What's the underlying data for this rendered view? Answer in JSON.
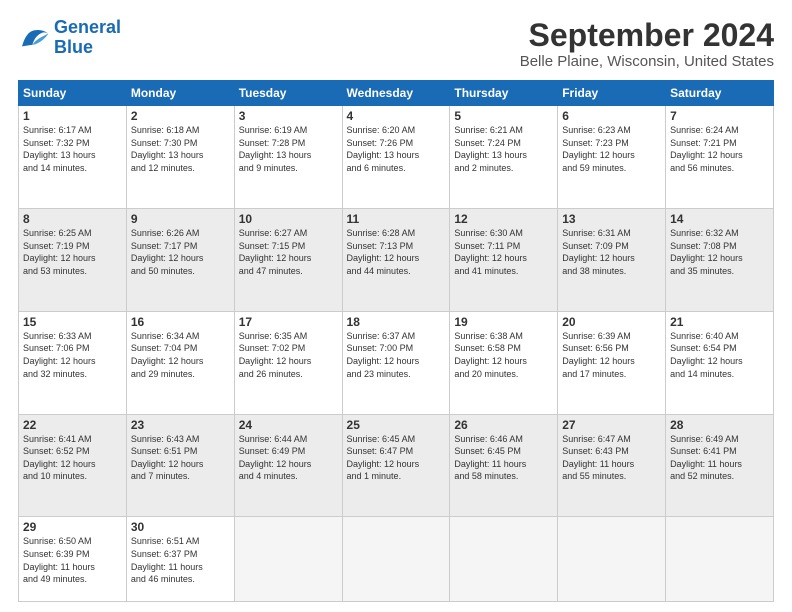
{
  "logo": {
    "line1": "General",
    "line2": "Blue"
  },
  "title": "September 2024",
  "subtitle": "Belle Plaine, Wisconsin, United States",
  "days_of_week": [
    "Sunday",
    "Monday",
    "Tuesday",
    "Wednesday",
    "Thursday",
    "Friday",
    "Saturday"
  ],
  "weeks": [
    [
      {
        "day": "1",
        "info": "Sunrise: 6:17 AM\nSunset: 7:32 PM\nDaylight: 13 hours\nand 14 minutes."
      },
      {
        "day": "2",
        "info": "Sunrise: 6:18 AM\nSunset: 7:30 PM\nDaylight: 13 hours\nand 12 minutes."
      },
      {
        "day": "3",
        "info": "Sunrise: 6:19 AM\nSunset: 7:28 PM\nDaylight: 13 hours\nand 9 minutes."
      },
      {
        "day": "4",
        "info": "Sunrise: 6:20 AM\nSunset: 7:26 PM\nDaylight: 13 hours\nand 6 minutes."
      },
      {
        "day": "5",
        "info": "Sunrise: 6:21 AM\nSunset: 7:24 PM\nDaylight: 13 hours\nand 2 minutes."
      },
      {
        "day": "6",
        "info": "Sunrise: 6:23 AM\nSunset: 7:23 PM\nDaylight: 12 hours\nand 59 minutes."
      },
      {
        "day": "7",
        "info": "Sunrise: 6:24 AM\nSunset: 7:21 PM\nDaylight: 12 hours\nand 56 minutes."
      }
    ],
    [
      {
        "day": "8",
        "info": "Sunrise: 6:25 AM\nSunset: 7:19 PM\nDaylight: 12 hours\nand 53 minutes."
      },
      {
        "day": "9",
        "info": "Sunrise: 6:26 AM\nSunset: 7:17 PM\nDaylight: 12 hours\nand 50 minutes."
      },
      {
        "day": "10",
        "info": "Sunrise: 6:27 AM\nSunset: 7:15 PM\nDaylight: 12 hours\nand 47 minutes."
      },
      {
        "day": "11",
        "info": "Sunrise: 6:28 AM\nSunset: 7:13 PM\nDaylight: 12 hours\nand 44 minutes."
      },
      {
        "day": "12",
        "info": "Sunrise: 6:30 AM\nSunset: 7:11 PM\nDaylight: 12 hours\nand 41 minutes."
      },
      {
        "day": "13",
        "info": "Sunrise: 6:31 AM\nSunset: 7:09 PM\nDaylight: 12 hours\nand 38 minutes."
      },
      {
        "day": "14",
        "info": "Sunrise: 6:32 AM\nSunset: 7:08 PM\nDaylight: 12 hours\nand 35 minutes."
      }
    ],
    [
      {
        "day": "15",
        "info": "Sunrise: 6:33 AM\nSunset: 7:06 PM\nDaylight: 12 hours\nand 32 minutes."
      },
      {
        "day": "16",
        "info": "Sunrise: 6:34 AM\nSunset: 7:04 PM\nDaylight: 12 hours\nand 29 minutes."
      },
      {
        "day": "17",
        "info": "Sunrise: 6:35 AM\nSunset: 7:02 PM\nDaylight: 12 hours\nand 26 minutes."
      },
      {
        "day": "18",
        "info": "Sunrise: 6:37 AM\nSunset: 7:00 PM\nDaylight: 12 hours\nand 23 minutes."
      },
      {
        "day": "19",
        "info": "Sunrise: 6:38 AM\nSunset: 6:58 PM\nDaylight: 12 hours\nand 20 minutes."
      },
      {
        "day": "20",
        "info": "Sunrise: 6:39 AM\nSunset: 6:56 PM\nDaylight: 12 hours\nand 17 minutes."
      },
      {
        "day": "21",
        "info": "Sunrise: 6:40 AM\nSunset: 6:54 PM\nDaylight: 12 hours\nand 14 minutes."
      }
    ],
    [
      {
        "day": "22",
        "info": "Sunrise: 6:41 AM\nSunset: 6:52 PM\nDaylight: 12 hours\nand 10 minutes."
      },
      {
        "day": "23",
        "info": "Sunrise: 6:43 AM\nSunset: 6:51 PM\nDaylight: 12 hours\nand 7 minutes."
      },
      {
        "day": "24",
        "info": "Sunrise: 6:44 AM\nSunset: 6:49 PM\nDaylight: 12 hours\nand 4 minutes."
      },
      {
        "day": "25",
        "info": "Sunrise: 6:45 AM\nSunset: 6:47 PM\nDaylight: 12 hours\nand 1 minute."
      },
      {
        "day": "26",
        "info": "Sunrise: 6:46 AM\nSunset: 6:45 PM\nDaylight: 11 hours\nand 58 minutes."
      },
      {
        "day": "27",
        "info": "Sunrise: 6:47 AM\nSunset: 6:43 PM\nDaylight: 11 hours\nand 55 minutes."
      },
      {
        "day": "28",
        "info": "Sunrise: 6:49 AM\nSunset: 6:41 PM\nDaylight: 11 hours\nand 52 minutes."
      }
    ],
    [
      {
        "day": "29",
        "info": "Sunrise: 6:50 AM\nSunset: 6:39 PM\nDaylight: 11 hours\nand 49 minutes."
      },
      {
        "day": "30",
        "info": "Sunrise: 6:51 AM\nSunset: 6:37 PM\nDaylight: 11 hours\nand 46 minutes."
      },
      {
        "day": "",
        "info": ""
      },
      {
        "day": "",
        "info": ""
      },
      {
        "day": "",
        "info": ""
      },
      {
        "day": "",
        "info": ""
      },
      {
        "day": "",
        "info": ""
      }
    ]
  ]
}
